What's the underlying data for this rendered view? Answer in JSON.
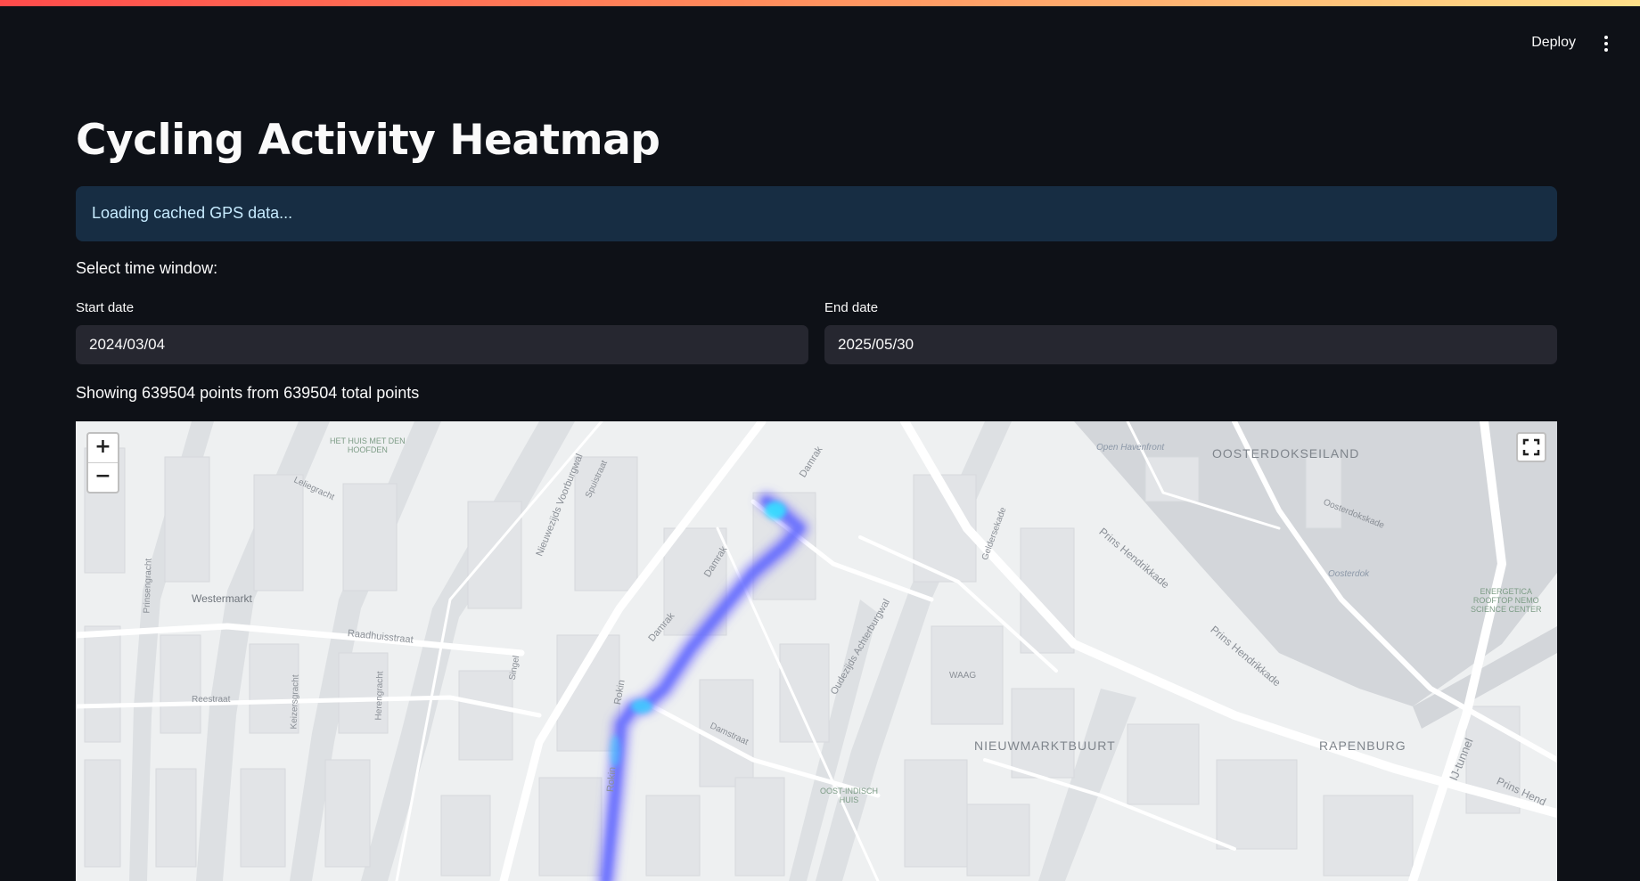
{
  "header": {
    "deploy_label": "Deploy",
    "menu_icon": "kebab-menu-icon"
  },
  "page": {
    "title": "Cycling Activity Heatmap",
    "info_message": "Loading cached GPS data...",
    "select_label": "Select time window:",
    "start_date": {
      "label": "Start date",
      "value": "2024/03/04"
    },
    "end_date": {
      "label": "End date",
      "value": "2025/05/30"
    },
    "summary": "Showing 639504 points from 639504 total points"
  },
  "map": {
    "zoom_in": "+",
    "zoom_out": "−",
    "fullscreen_icon": "fullscreen-icon",
    "heat_color": "#6f6bff",
    "heat_hot_color": "#34e0ff",
    "labels": {
      "oosterdokseiland": "OOSTERDOKSEILAND",
      "nieuwmarktbuurt": "NIEUWMARKTBUURT",
      "rapenburg": "RAPENBURG",
      "waag": "WAAG",
      "westermarkt": "Westermarkt",
      "raadhuisstraat": "Raadhuisstraat",
      "reestraat": "Reestraat",
      "open_havenfront": "Open Havenfront",
      "oosterdok": "Oosterdok",
      "het_huis": "HET HUIS MET DEN\nHOOFDEN",
      "energetica": "ENERGETICA\nROOFTOP NEMO\nSCIENCE CENTER",
      "oost_indisch": "OOST-INDISCH\nHUIS",
      "damrak1": "Damrak",
      "damrak2": "Damrak",
      "damrak3": "Damrak",
      "rokin1": "Rokin",
      "rokin2": "Rokin",
      "prins_hendrikkade1": "Prins Hendrikkade",
      "prins_hendrikkade2": "Prins Hendrikkade",
      "prins_hendrikkade3": "Prins Hend",
      "nieuwezijds": "Nieuwezijds Voorburgwal",
      "oudezijds": "Oudezijds Achterburgwal",
      "spuistraat": "Spuistraat",
      "singel": "Singel",
      "keizersgracht": "Keizersgracht",
      "herengracht": "Herengracht",
      "prinsengracht": "Prinsengracht",
      "leliegracht": "Leliegracht",
      "ij_tunnel": "IJ-tunnel",
      "oosterdokskade": "Oosterdokskade",
      "damstraat": "Damstraat",
      "geldersekade": "Geldersekade"
    }
  }
}
